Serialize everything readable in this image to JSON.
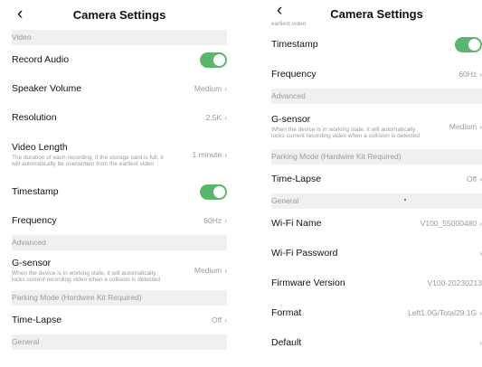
{
  "left": {
    "title": "Camera Settings",
    "sections": {
      "video": "Video",
      "advanced": "Advanced",
      "parking": "Parking Mode (Hardwire Kit Required)",
      "general": "General"
    },
    "record_audio": {
      "label": "Record Audio",
      "on": true
    },
    "speaker_volume": {
      "label": "Speaker Volume",
      "value": "Medium"
    },
    "resolution": {
      "label": "Resolution",
      "value": "2.5K"
    },
    "video_length": {
      "label": "Video Length",
      "desc": "The duration of each recording, if the storage card is full, it will automatically be overwritten from the earliest video",
      "value": "1 minute"
    },
    "timestamp": {
      "label": "Timestamp",
      "on": true
    },
    "frequency": {
      "label": "Frequency",
      "value": "60Hz"
    },
    "g_sensor": {
      "label": "G-sensor",
      "desc": "When the device is in working state, it will automatically locks current recording video when a collision is detected",
      "value": "Medium"
    },
    "time_lapse": {
      "label": "Time-Lapse",
      "value": "Off"
    }
  },
  "right": {
    "title": "Camera Settings",
    "top_desc": "earliest video",
    "sections": {
      "advanced": "Advanced",
      "parking": "Parking Mode (Hardwire Kit Required)",
      "general": "General"
    },
    "timestamp": {
      "label": "Timestamp",
      "on": true
    },
    "frequency": {
      "label": "Frequency",
      "value": "60Hz"
    },
    "g_sensor": {
      "label": "G-sensor",
      "desc": "When the device is in working state, it will automatically locks current recording video when a collision is detected",
      "value": "Medium"
    },
    "time_lapse": {
      "label": "Time-Lapse",
      "value": "Off"
    },
    "wifi_name": {
      "label": "Wi-Fi Name",
      "value": "V100_55000480"
    },
    "wifi_password": {
      "label": "Wi-Fi Password",
      "value": ""
    },
    "firmware": {
      "label": "Firmware Version",
      "value": "V100-20230213"
    },
    "format": {
      "label": "Format",
      "value": "Left1.0G/Total29.1G"
    },
    "default": {
      "label": "Default",
      "value": ""
    }
  },
  "icons": {
    "back": "chevron-left-icon",
    "chevron": "chevron-right-icon"
  },
  "colors": {
    "toggle_on": "#5ab66a",
    "section_bg": "#f0f0f0",
    "muted_text": "#9a9a9a"
  }
}
